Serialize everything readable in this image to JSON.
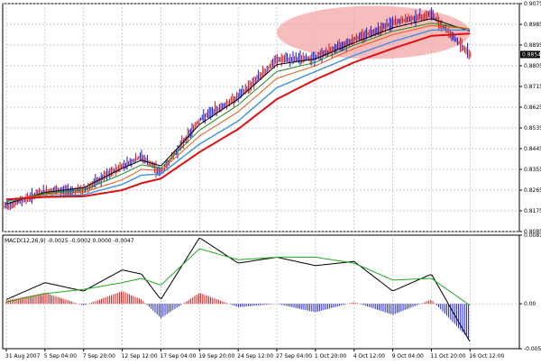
{
  "chart_data": [
    {
      "type": "candlestick",
      "panel": "price",
      "ylim": [
        0.8085,
        0.9075
      ],
      "y_ticks": [
        0.8085,
        0.8175,
        0.8265,
        0.8355,
        0.8445,
        0.8535,
        0.8625,
        0.8715,
        0.8805,
        0.8895,
        0.8985,
        0.9075
      ],
      "y_tick_labels": [
        "0.8085",
        "0.8175",
        "0.8265",
        "0.8355",
        "0.8445",
        "0.8535",
        "0.8625",
        "0.8715",
        "0.8805",
        "0.8895",
        "0.8985",
        "0.9075"
      ],
      "current_price_label": "0.8854",
      "current_price": 0.8854,
      "x_labels": [
        "31 Aug 2007",
        "5 Sep 04:00",
        "7 Sep 20:00",
        "12 Sep 12:00",
        "17 Sep 04:00",
        "19 Sep 20:00",
        "24 Sep 12:00",
        "27 Sep 04:00",
        "1 Oct 20:00",
        "4 Oct 12:00",
        "9 Oct 04:00",
        "11 Oct 20:00",
        "16 Oct 12:00"
      ],
      "grid": true,
      "highlight": {
        "shape": "ellipse",
        "color": "#f4a6a6",
        "x_range": [
          "27 Sep 04:00",
          "16 Oct 12:00"
        ],
        "y_range": [
          0.8835,
          0.9065
        ]
      },
      "close_series": {
        "x": [
          "31 Aug 2007",
          "5 Sep 04:00",
          "7 Sep 20:00",
          "12 Sep 12:00",
          "15 Sep 12:00",
          "17 Sep 04:00",
          "19 Sep 20:00",
          "24 Sep 12:00",
          "27 Sep 04:00",
          "1 Oct 20:00",
          "4 Oct 12:00",
          "9 Oct 04:00",
          "11 Oct 20:00",
          "16 Oct 12:00"
        ],
        "values": [
          0.8195,
          0.826,
          0.8265,
          0.837,
          0.841,
          0.834,
          0.857,
          0.867,
          0.883,
          0.884,
          0.892,
          0.899,
          0.903,
          0.8854
        ]
      },
      "series": [
        {
          "values": [
            0.8205,
            0.8255,
            0.8275,
            0.836,
            0.8395,
            0.837,
            0.855,
            0.866,
            0.881,
            0.8835,
            0.8905,
            0.897,
            0.901,
            0.8955
          ],
          "color": "#000000"
        },
        {
          "values": [
            0.8215,
            0.825,
            0.8265,
            0.8335,
            0.8375,
            0.836,
            0.8525,
            0.8635,
            0.878,
            0.882,
            0.8895,
            0.8955,
            0.899,
            0.8965
          ],
          "color": "#1f8a1f"
        },
        {
          "values": [
            0.822,
            0.8245,
            0.8255,
            0.831,
            0.8355,
            0.835,
            0.85,
            0.8605,
            0.875,
            0.8805,
            0.888,
            0.894,
            0.898,
            0.8965
          ],
          "color": "#e8561a"
        },
        {
          "values": [
            0.822,
            0.8238,
            0.8245,
            0.829,
            0.833,
            0.8335,
            0.8465,
            0.8565,
            0.871,
            0.878,
            0.885,
            0.891,
            0.896,
            0.896
          ],
          "color": "#3c8fe0"
        },
        {
          "values": [
            0.8225,
            0.8235,
            0.8238,
            0.8265,
            0.8295,
            0.8315,
            0.843,
            0.853,
            0.866,
            0.8745,
            0.882,
            0.888,
            0.8935,
            0.8945
          ],
          "color": "#e01010"
        }
      ]
    },
    {
      "type": "macd",
      "panel": "indicator",
      "title": "MACD(12,26,9) -0.0025 -0.0002 0.0000 -0.0047",
      "ylim": [
        -0.0053,
        0.0081
      ],
      "y_tick_labels": [
        "0.0081",
        "0.00",
        "-0.0053"
      ],
      "y_ticks": [
        0.0081,
        0.0,
        -0.0053
      ],
      "x": [
        "31 Aug 2007",
        "5 Sep 04:00",
        "7 Sep 20:00",
        "12 Sep 12:00",
        "15 Sep 12:00",
        "17 Sep 04:00",
        "19 Sep 20:00",
        "24 Sep 12:00",
        "27 Sep 04:00",
        "1 Oct 20:00",
        "4 Oct 12:00",
        "9 Oct 04:00",
        "11 Oct 20:00",
        "16 Oct 12:00"
      ],
      "series": [
        {
          "values": [
            0.0005,
            0.0025,
            0.0015,
            0.004,
            0.0035,
            0.0005,
            0.0078,
            0.0048,
            0.0055,
            0.0045,
            0.005,
            0.0015,
            0.0035,
            -0.0045
          ],
          "color": "#000000"
        },
        {
          "values": [
            0.0002,
            0.0012,
            0.0017,
            0.0025,
            0.003,
            0.0022,
            0.0065,
            0.0052,
            0.0055,
            0.0055,
            0.0048,
            0.0028,
            0.003,
            -0.0002
          ],
          "color": "#1faa1f"
        }
      ],
      "histogram": {
        "values": [
          0.0004,
          0.0013,
          -0.0002,
          0.0015,
          0.0005,
          -0.0017,
          0.0013,
          -0.0004,
          0.0,
          -0.001,
          0.0002,
          -0.0013,
          0.0005,
          -0.0043
        ],
        "positive_color": "#e01010",
        "negative_color": "#2020e0"
      }
    }
  ]
}
